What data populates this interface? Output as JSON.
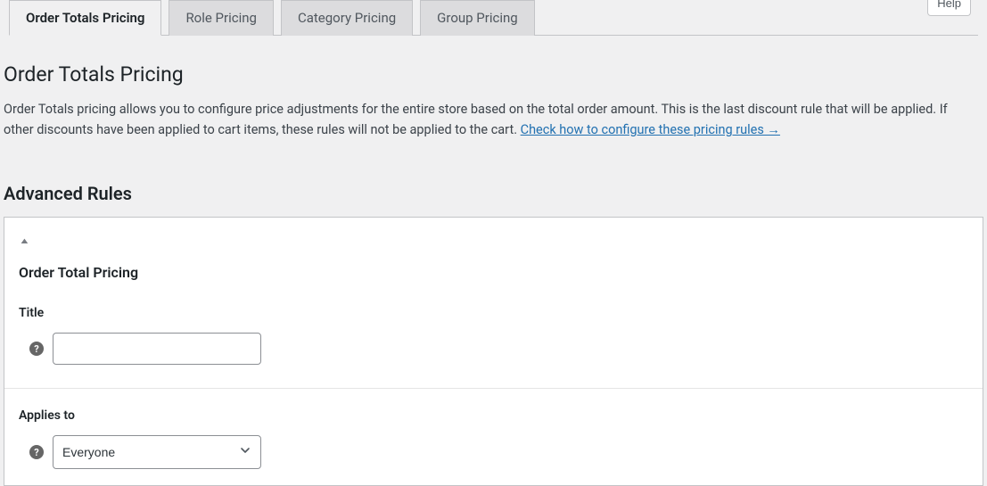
{
  "help_button": "Help",
  "tabs": {
    "order_totals": "Order Totals Pricing",
    "role": "Role Pricing",
    "category": "Category Pricing",
    "group": "Group Pricing"
  },
  "page": {
    "title": "Order Totals Pricing",
    "description_part1": "Order Totals pricing allows you to configure price adjustments for the entire store based on the total order amount. This is the last discount rule that will be applied. If other discounts have been applied to cart items, these rules will not be applied to the cart. ",
    "description_link": "Check how to configure these pricing rules →"
  },
  "section_title": "Advanced Rules",
  "panel": {
    "heading": "Order Total Pricing",
    "title_label": "Title",
    "title_value": "",
    "applies_to_label": "Applies to",
    "applies_to_value": "Everyone"
  }
}
